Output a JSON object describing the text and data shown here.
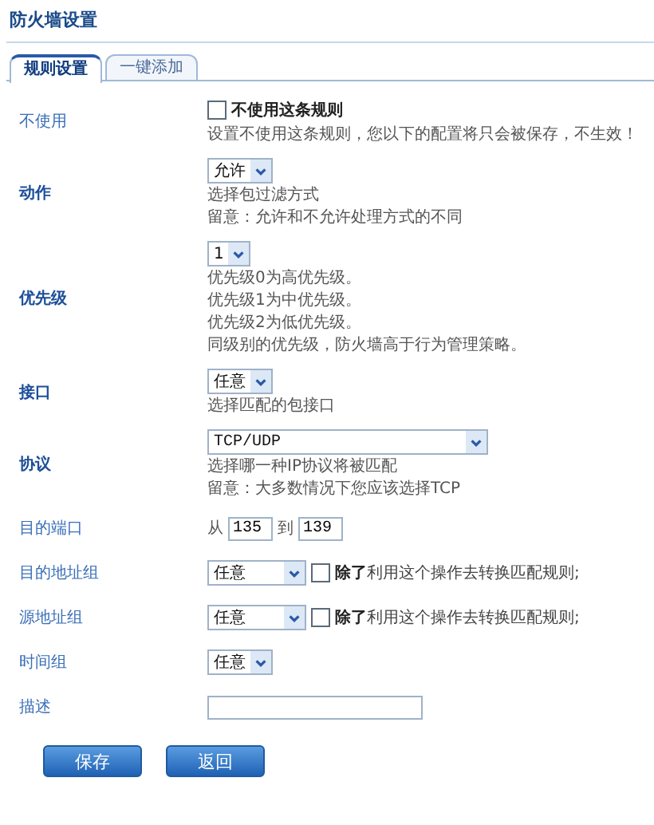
{
  "title": "防火墙设置",
  "tabs": [
    {
      "label": "规则设置",
      "selected": true
    },
    {
      "label": "一键添加",
      "selected": false
    }
  ],
  "rows": [
    {
      "label": "不使用",
      "emphasized": false,
      "kind": "checkbox",
      "checkbox": {
        "label": "不使用这条规则",
        "checked": false
      },
      "notes": [
        "设置不使用这条规则，您以下的配置将只会被保存，不生效！"
      ]
    },
    {
      "label": "动作",
      "emphasized": true,
      "kind": "select",
      "select": {
        "value": "允许"
      },
      "notes": [
        "选择包过滤方式",
        "留意：允许和不允许处理方式的不同"
      ]
    },
    {
      "label": "优先级",
      "emphasized": true,
      "kind": "select",
      "select": {
        "value": "1"
      },
      "notes": [
        "优先级0为高优先级。",
        "优先级1为中优先级。",
        "优先级2为低优先级。",
        "同级别的优先级，防火墙高于行为管理策略。"
      ]
    },
    {
      "label": "接口",
      "emphasized": true,
      "kind": "select",
      "select": {
        "value": "任意"
      },
      "notes": [
        "选择匹配的包接口"
      ]
    },
    {
      "label": "协议",
      "emphasized": true,
      "kind": "wide-select",
      "select": {
        "value": "TCP/UDP"
      },
      "notes": [
        "选择哪一种IP协议将被匹配",
        "留意：大多数情况下您应该选择TCP"
      ]
    },
    {
      "label": "目的端口",
      "emphasized": false,
      "kind": "range",
      "range": {
        "from_label": "从",
        "from": "135",
        "to_label": "到",
        "to": "139"
      }
    },
    {
      "label": "目的地址组",
      "emphasized": false,
      "kind": "select-check",
      "select": {
        "value": "任意"
      },
      "checkbox": {
        "label": "**除了**利用这个操作去转换匹配规则;",
        "checked": false
      }
    },
    {
      "label": "源地址组",
      "emphasized": false,
      "kind": "select-check",
      "select": {
        "value": "任意"
      },
      "checkbox": {
        "label": "**除了**利用这个操作去转换匹配规则;",
        "checked": false
      }
    },
    {
      "label": "时间组",
      "emphasized": false,
      "kind": "select",
      "select": {
        "value": "任意"
      }
    },
    {
      "label": "描述",
      "emphasized": false,
      "kind": "text"
    }
  ],
  "buttons": [
    "保存",
    "返回"
  ]
}
